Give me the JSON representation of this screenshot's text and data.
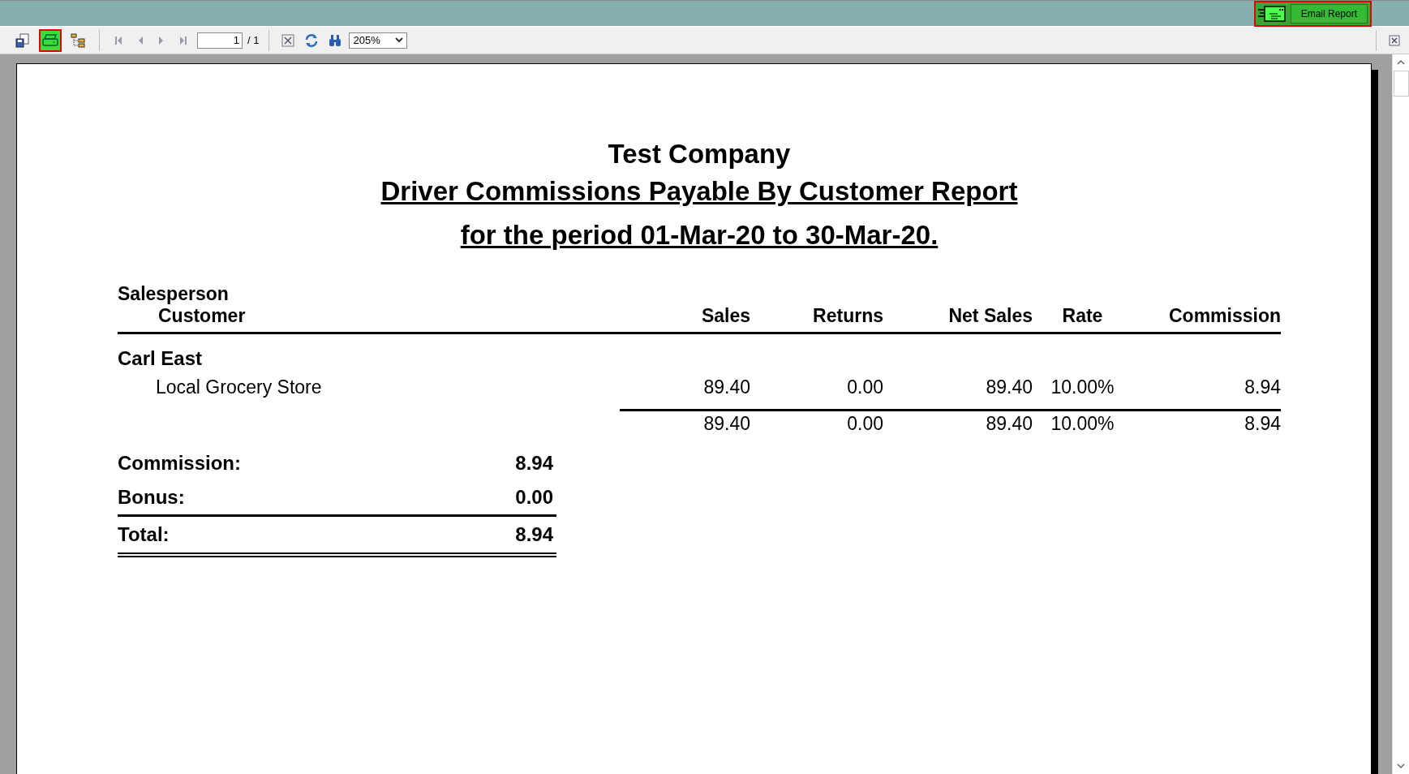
{
  "header": {
    "email_button": {
      "label": "Email Report",
      "highlighted": true
    }
  },
  "toolbar": {
    "tools": [
      {
        "kind": "export",
        "highlighted": false
      },
      {
        "kind": "print",
        "highlighted": true
      },
      {
        "kind": "tree",
        "highlighted": false
      }
    ],
    "page_field": {
      "value": "1"
    },
    "page_total": "/ 1",
    "zoom": {
      "value": "205%"
    }
  },
  "report": {
    "company": "Test Company",
    "title": "Driver Commissions Payable By Customer Report",
    "period": "for the period 01-Mar-20 to 30-Mar-20.",
    "header_salesperson": "Salesperson",
    "header_customer": "Customer",
    "columns": [
      "Sales",
      "Returns",
      "Net Sales",
      "Rate",
      "Commission"
    ],
    "groups": [
      {
        "salesperson": "Carl East",
        "rows": [
          {
            "customer": "Local Grocery Store",
            "values": [
              "89.40",
              "0.00",
              "89.40",
              "10.00%",
              "8.94"
            ]
          }
        ],
        "subtotal": [
          "89.40",
          "0.00",
          "89.40",
          "10.00%",
          "8.94"
        ]
      }
    ],
    "summary": [
      {
        "kind": "line",
        "label": "Commission:",
        "value": "8.94"
      },
      {
        "kind": "line",
        "label": "Bonus:",
        "value": "0.00"
      },
      {
        "kind": "total",
        "label": "Total:",
        "value": "8.94"
      }
    ]
  }
}
